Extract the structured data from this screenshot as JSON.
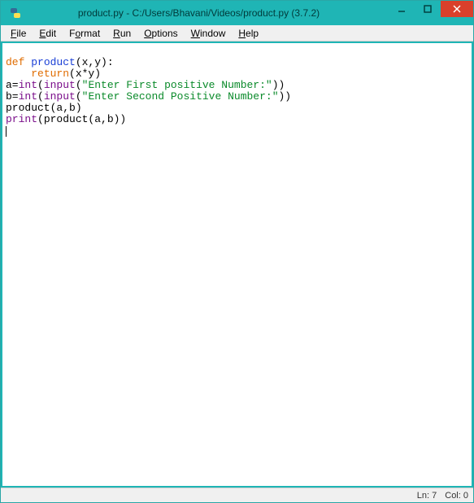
{
  "window": {
    "title": "product.py - C:/Users/Bhavani/Videos/product.py (3.7.2)"
  },
  "menu": {
    "file": "File",
    "edit": "Edit",
    "format": "Format",
    "run": "Run",
    "options": "Options",
    "window": "Window",
    "help": "Help"
  },
  "code": {
    "l1": {
      "kw": "def ",
      "name": "product",
      "rest": "(x,y):"
    },
    "l2": {
      "indent": "    ",
      "kw": "return",
      "rest": "(x*y)"
    },
    "l3": {
      "pre": "a=",
      "fn1": "int",
      "p1": "(",
      "fn2": "input",
      "p2": "(",
      "str": "\"Enter First positive Number:\"",
      "post": "))"
    },
    "l4": {
      "pre": "b=",
      "fn1": "int",
      "p1": "(",
      "fn2": "input",
      "p2": "(",
      "str": "\"Enter Second Positive Number:\"",
      "post": "))"
    },
    "l5": {
      "text": "product(a,b)"
    },
    "l6": {
      "fn": "print",
      "rest": "(product(a,b))"
    }
  },
  "status": {
    "ln": "Ln: 7",
    "col": "Col: 0"
  }
}
